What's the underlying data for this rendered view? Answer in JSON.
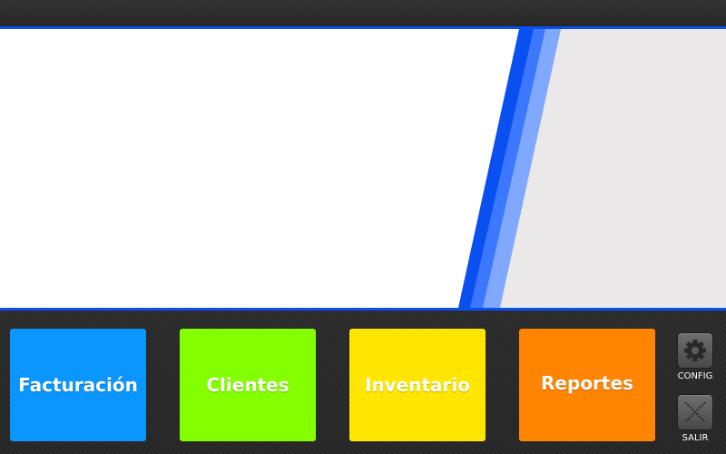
{
  "menu": {
    "tiles": [
      {
        "label": "Facturación",
        "color": "#0a95ff"
      },
      {
        "label": "Clientes",
        "color": "#84ff00"
      },
      {
        "label": "Inventario",
        "color": "#ffe600"
      },
      {
        "label": "Reportes",
        "color": "#ff8400"
      }
    ]
  },
  "side": {
    "config_label": "CONFIG",
    "config_icon": "gear-icon",
    "exit_label": "SALIR",
    "exit_icon": "close-icon"
  },
  "colors": {
    "accent_blue": "#0a4ff0",
    "stripe_mid": "#3b78ff",
    "stripe_light": "#80a8ff",
    "panel_gray": "#eae8e8",
    "background_dark": "#2c2c2c"
  }
}
